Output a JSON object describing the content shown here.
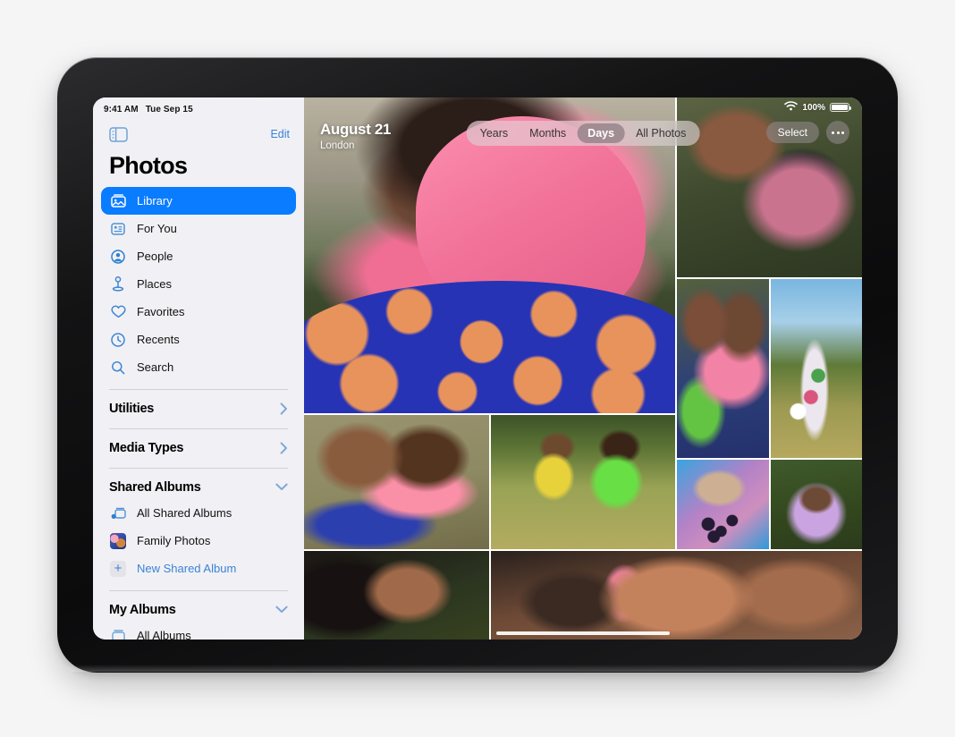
{
  "device": {
    "name": "ipad-pro"
  },
  "status_bar": {
    "time": "9:41 AM",
    "date": "Tue Sep 15",
    "wifi_icon": "wifi-icon",
    "battery_percent": "100%",
    "battery_icon": "battery-full-icon"
  },
  "sidebar": {
    "toggle_icon": "sidebar-toggle-icon",
    "edit_label": "Edit",
    "title": "Photos",
    "nav_items": [
      {
        "label": "Library",
        "icon": "photo-stack-icon",
        "selected": true
      },
      {
        "label": "For You",
        "icon": "for-you-card-icon",
        "selected": false
      },
      {
        "label": "People",
        "icon": "person-circle-icon",
        "selected": false
      },
      {
        "label": "Places",
        "icon": "map-pin-icon",
        "selected": false
      },
      {
        "label": "Favorites",
        "icon": "heart-icon",
        "selected": false
      },
      {
        "label": "Recents",
        "icon": "clock-icon",
        "selected": false
      },
      {
        "label": "Search",
        "icon": "magnifier-icon",
        "selected": false
      }
    ],
    "sections": [
      {
        "label": "Utilities",
        "chevron": "chevron-right-icon"
      },
      {
        "label": "Media Types",
        "chevron": "chevron-right-icon"
      },
      {
        "label": "Shared Albums",
        "chevron": "chevron-down-icon"
      }
    ],
    "shared_items": [
      {
        "label": "All Shared Albums",
        "icon": "shared-albums-icon",
        "style": "normal"
      },
      {
        "label": "Family Photos",
        "icon": "album-thumbnail",
        "style": "normal"
      },
      {
        "label": "New Shared Album",
        "icon": "plus-icon",
        "style": "link"
      }
    ],
    "my_albums_section": {
      "label": "My Albums",
      "chevron": "chevron-down-icon"
    },
    "my_albums_items": [
      {
        "label": "All Albums",
        "icon": "albums-folder-icon"
      }
    ]
  },
  "photos_view": {
    "date_title": "August 21",
    "location": "London",
    "segmented_control": {
      "options": [
        "Years",
        "Months",
        "Days",
        "All Photos"
      ],
      "selected": "Days"
    },
    "select_label": "Select",
    "more_icon": "ellipsis-icon",
    "home_indicator": "home-indicator"
  },
  "colors": {
    "accent_blue": "#0a7cff",
    "link_blue": "#3b82d6",
    "sidebar_bg": "#f1f1f5",
    "page_bg": "#f5f5f6",
    "frame_black": "#131314"
  },
  "grid": {
    "photos": [
      {
        "name": "photo-woman-pink-headscarf-large"
      },
      {
        "name": "photo-two-women-portrait"
      },
      {
        "name": "photo-mother-daughter-green"
      },
      {
        "name": "photo-woman-floral-field"
      },
      {
        "name": "photo-girl-and-woman-embrace"
      },
      {
        "name": "photo-two-girls-meadow"
      },
      {
        "name": "photo-berries-on-blanket"
      },
      {
        "name": "photo-woman-purple-headscarf"
      },
      {
        "name": "photo-woman-curly-hair-profile"
      },
      {
        "name": "photo-family-kiss-selfie"
      }
    ]
  }
}
